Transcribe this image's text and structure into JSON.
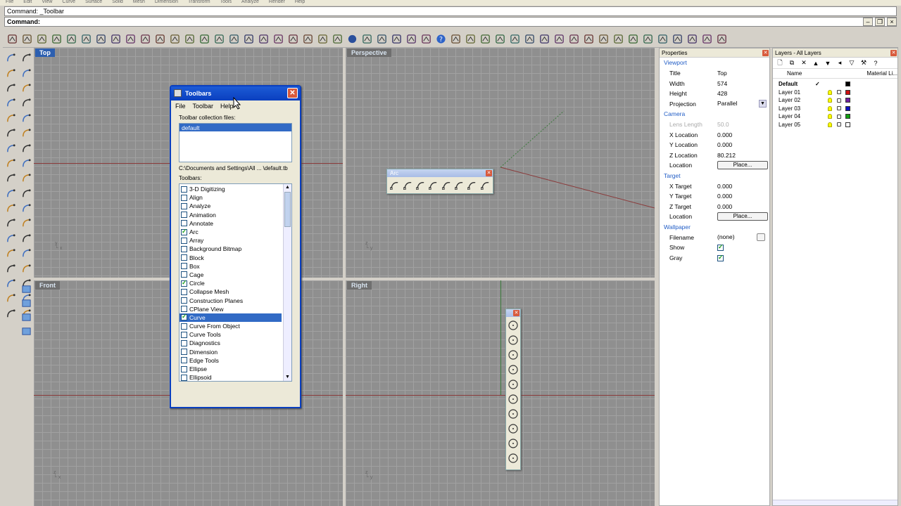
{
  "menu": [
    "File",
    "Edit",
    "View",
    "Curve",
    "Surface",
    "Solid",
    "Mesh",
    "Dimension",
    "Transform",
    "Tools",
    "Analyze",
    "Render",
    "Help"
  ],
  "command_history": "Command: _Toolbar",
  "command_prompt": "Command:",
  "viewports": {
    "top": "Top",
    "perspective": "Perspective",
    "front": "Front",
    "right": "Right"
  },
  "toolbars_dialog": {
    "title": "Toolbars",
    "menu": [
      "File",
      "Toolbar",
      "Help"
    ],
    "collection_label": "Toolbar collection files:",
    "collection_selected": "default",
    "path": "C:\\Documents and Settings\\All ... \\default.tb",
    "toolbars_label": "Toolbars:",
    "items": [
      {
        "label": "3-D Digitizing",
        "checked": false,
        "selected": false
      },
      {
        "label": "Align",
        "checked": false,
        "selected": false
      },
      {
        "label": "Analyze",
        "checked": false,
        "selected": false
      },
      {
        "label": "Animation",
        "checked": false,
        "selected": false
      },
      {
        "label": "Annotate",
        "checked": false,
        "selected": false
      },
      {
        "label": "Arc",
        "checked": true,
        "selected": false
      },
      {
        "label": "Array",
        "checked": false,
        "selected": false
      },
      {
        "label": "Background Bitmap",
        "checked": false,
        "selected": false
      },
      {
        "label": "Block",
        "checked": false,
        "selected": false
      },
      {
        "label": "Box",
        "checked": false,
        "selected": false
      },
      {
        "label": "Cage",
        "checked": false,
        "selected": false
      },
      {
        "label": "Circle",
        "checked": true,
        "selected": false
      },
      {
        "label": "Collapse Mesh",
        "checked": false,
        "selected": false
      },
      {
        "label": "Construction Planes",
        "checked": false,
        "selected": false
      },
      {
        "label": "CPlane View",
        "checked": false,
        "selected": false
      },
      {
        "label": "Curve",
        "checked": true,
        "selected": true
      },
      {
        "label": "Curve From Object",
        "checked": false,
        "selected": false
      },
      {
        "label": "Curve Tools",
        "checked": false,
        "selected": false
      },
      {
        "label": "Diagnostics",
        "checked": false,
        "selected": false
      },
      {
        "label": "Dimension",
        "checked": false,
        "selected": false
      },
      {
        "label": "Edge Tools",
        "checked": false,
        "selected": false
      },
      {
        "label": "Ellipse",
        "checked": false,
        "selected": false
      },
      {
        "label": "Ellipsoid",
        "checked": false,
        "selected": false
      }
    ]
  },
  "arc_toolbar": {
    "title": "Arc"
  },
  "properties": {
    "header": "Properties",
    "viewport_section": "Viewport",
    "title_k": "Title",
    "title_v": "Top",
    "width_k": "Width",
    "width_v": "574",
    "height_k": "Height",
    "height_v": "428",
    "projection_k": "Projection",
    "projection_v": "Parallel",
    "camera_section": "Camera",
    "lens_k": "Lens Length",
    "lens_v": "50.0",
    "xloc_k": "X Location",
    "xloc_v": "0.000",
    "yloc_k": "Y Location",
    "yloc_v": "0.000",
    "zloc_k": "Z Location",
    "zloc_v": "80.212",
    "loc_k": "Location",
    "place_label": "Place...",
    "target_section": "Target",
    "xt_k": "X Target",
    "xt_v": "0.000",
    "yt_k": "Y Target",
    "yt_v": "0.000",
    "zt_k": "Z Target",
    "zt_v": "0.000",
    "tloc_k": "Location",
    "wallpaper_section": "Wallpaper",
    "filename_k": "Filename",
    "filename_v": "(none)",
    "show_k": "Show",
    "gray_k": "Gray"
  },
  "layers": {
    "header": "Layers - All Layers",
    "col_name": "Name",
    "col_material": "Material Li...",
    "rows": [
      {
        "name": "Default",
        "color": "#000000",
        "current": true
      },
      {
        "name": "Layer 01",
        "color": "#d01010",
        "current": false
      },
      {
        "name": "Layer 02",
        "color": "#7020a0",
        "current": false
      },
      {
        "name": "Layer 03",
        "color": "#1010c0",
        "current": false
      },
      {
        "name": "Layer 04",
        "color": "#10a010",
        "current": false
      },
      {
        "name": "Layer 05",
        "color": "#ffffff",
        "current": false
      }
    ]
  },
  "colors": {
    "accent": "#0a3fbf",
    "selection": "#316ac5",
    "section": "#215dc6"
  }
}
